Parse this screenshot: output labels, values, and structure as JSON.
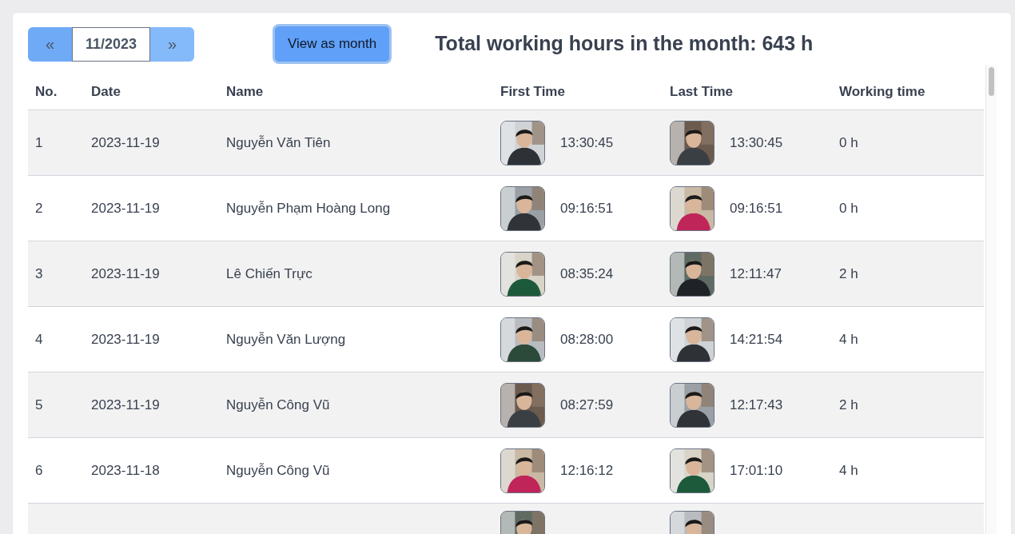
{
  "month_picker": {
    "prev": "«",
    "value": "11/2023",
    "next": "»"
  },
  "view_button": "View as month",
  "total": "Total working hours in the month: 643 h",
  "table": {
    "columns": [
      "No.",
      "Date",
      "Name",
      "First Time",
      "Last Time",
      "Working time"
    ],
    "rows": [
      {
        "no": "1",
        "date": "2023-11-19",
        "name": "Nguyễn Văn Tiên",
        "first_time": "13:30:45",
        "last_time": "13:30:45",
        "working_time": "0 h"
      },
      {
        "no": "2",
        "date": "2023-11-19",
        "name": "Nguyễn Phạm Hoàng Long",
        "first_time": "09:16:51",
        "last_time": "09:16:51",
        "working_time": "0 h"
      },
      {
        "no": "3",
        "date": "2023-11-19",
        "name": "Lê Chiến Trực",
        "first_time": "08:35:24",
        "last_time": "12:11:47",
        "working_time": "2 h"
      },
      {
        "no": "4",
        "date": "2023-11-19",
        "name": "Nguyễn Văn Lượng",
        "first_time": "08:28:00",
        "last_time": "14:21:54",
        "working_time": "4 h"
      },
      {
        "no": "5",
        "date": "2023-11-19",
        "name": "Nguyễn Công Vũ",
        "first_time": "08:27:59",
        "last_time": "12:17:43",
        "working_time": "2 h"
      },
      {
        "no": "6",
        "date": "2023-11-18",
        "name": "Nguyễn Công Vũ",
        "first_time": "12:16:12",
        "last_time": "17:01:10",
        "working_time": "4 h"
      }
    ]
  }
}
